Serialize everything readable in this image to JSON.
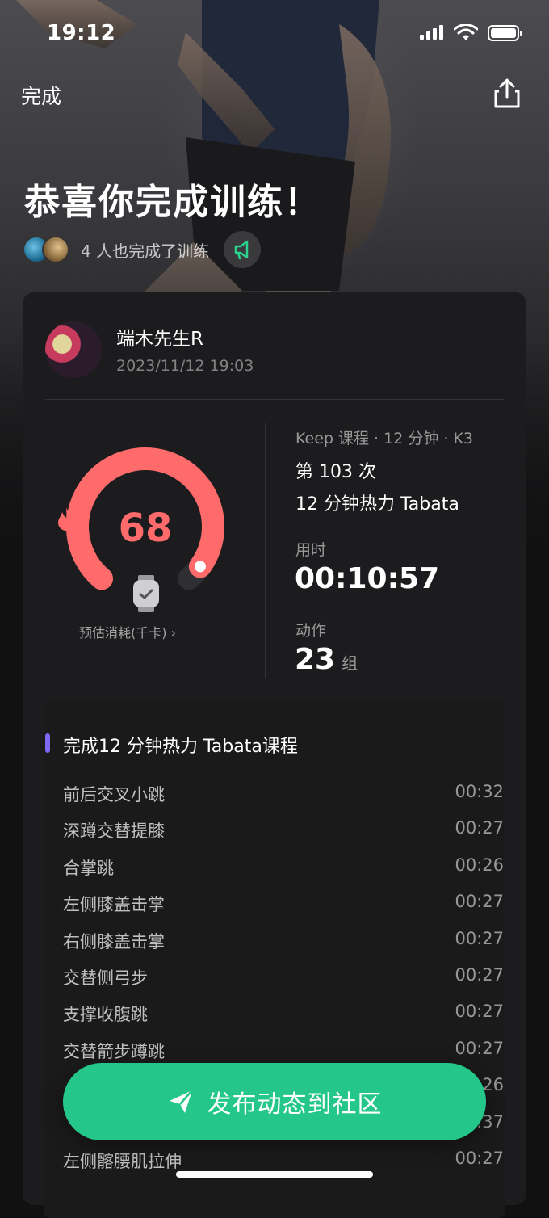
{
  "status_bar": {
    "time": "19:12",
    "icons": [
      "cellular-signal-icon",
      "wifi-icon",
      "battery-icon"
    ]
  },
  "nav": {
    "done_label": "完成",
    "share_icon": "share-icon"
  },
  "header": {
    "title": "恭喜你完成训练！",
    "social_text": "4 人也完成了训练",
    "social_icon": "megaphone-icon"
  },
  "user": {
    "name": "端木先生R",
    "datetime": "2023/11/12 19:03"
  },
  "summary": {
    "calories": "68",
    "calories_label": "预估消耗(千卡) ›",
    "calories_progress": 0.95,
    "meta": "Keep 课程 · 12 分钟 · K3",
    "count": "第 103 次",
    "course_name": "12 分钟热力 Tabata",
    "duration_label": "用时",
    "duration": "00:10:57",
    "actions_label": "动作",
    "actions_value": "23",
    "actions_unit": "组"
  },
  "exercise_list": {
    "title": "完成12 分钟热力 Tabata课程",
    "items": [
      {
        "name": "前后交叉小跳",
        "time": "00:32"
      },
      {
        "name": "深蹲交替提膝",
        "time": "00:27"
      },
      {
        "name": "合掌跳",
        "time": "00:26"
      },
      {
        "name": "左侧膝盖击掌",
        "time": "00:27"
      },
      {
        "name": "右侧膝盖击掌",
        "time": "00:27"
      },
      {
        "name": "交替侧弓步",
        "time": "00:27"
      },
      {
        "name": "支撑收腹跳",
        "time": "00:27"
      },
      {
        "name": "交替箭步蹲跳",
        "time": "00:27"
      },
      {
        "name": "",
        "time": "26"
      },
      {
        "name": "",
        "time": ":37"
      },
      {
        "name": "左侧髂腰肌拉伸",
        "time": "00:27"
      }
    ]
  },
  "post_button": {
    "label": "发布动态到社区",
    "icon": "send-icon"
  },
  "colors": {
    "accent_green": "#24c789",
    "calorie_red": "#ff6b6b",
    "section_purple": "#7c6af2"
  }
}
